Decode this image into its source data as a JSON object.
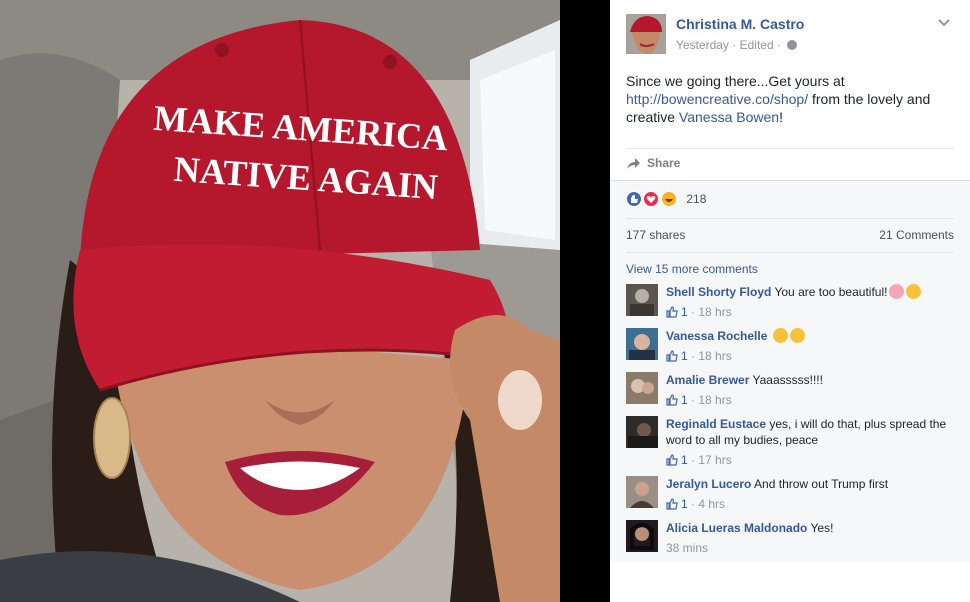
{
  "post": {
    "author": "Christina M. Castro",
    "time": "Yesterday",
    "edited": "Edited",
    "dot": "·",
    "text_before_link": "Since we going there...Get yours at",
    "link": "http://bowencreative.co/shop/",
    "text_after_link": " from the lovely and creative ",
    "mention": "Vanessa Bowen",
    "text_end": "!",
    "share_label": "Share",
    "reaction_count": "218",
    "shares": "177 shares",
    "comments_count": "21 Comments",
    "more_comments": "View 15 more comments"
  },
  "photo": {
    "cap_line1": "MAKE AMERICA",
    "cap_line2": "NATIVE AGAIN"
  },
  "colors": {
    "link": "#365899",
    "cap_red": "#b5172c",
    "like_blue": "#4267b2",
    "love_red": "#f0284a",
    "haha_yellow": "#f7b125"
  },
  "icons": [
    "chevron-down-icon",
    "globe-icon",
    "share-arrow-icon",
    "like-reaction-icon",
    "love-reaction-icon",
    "haha-reaction-icon",
    "thumbs-up-icon",
    "heart-emoji-icon",
    "wink-emoji-icon",
    "heart-eyes-emoji-icon"
  ],
  "comments": [
    {
      "name": "Shell Shorty Floyd",
      "text": "You are too beautiful!",
      "likes": "1",
      "time": "18 hrs"
    },
    {
      "name": "Vanessa Rochelle",
      "text": "",
      "likes": "1",
      "time": "18 hrs"
    },
    {
      "name": "Amalie Brewer",
      "text": "Yaaasssss!!!!",
      "likes": "1",
      "time": "18 hrs"
    },
    {
      "name": "Reginald Eustace",
      "text": "yes, i will do that, plus spread the word to all my budies, peace",
      "likes": "1",
      "time": "17 hrs"
    },
    {
      "name": "Jeralyn Lucero",
      "text": "And throw out Trump first",
      "likes": "1",
      "time": "4 hrs"
    },
    {
      "name": "Alicia Lueras Maldonado",
      "text": "Yes!",
      "likes": "",
      "time": "38 mins"
    }
  ]
}
